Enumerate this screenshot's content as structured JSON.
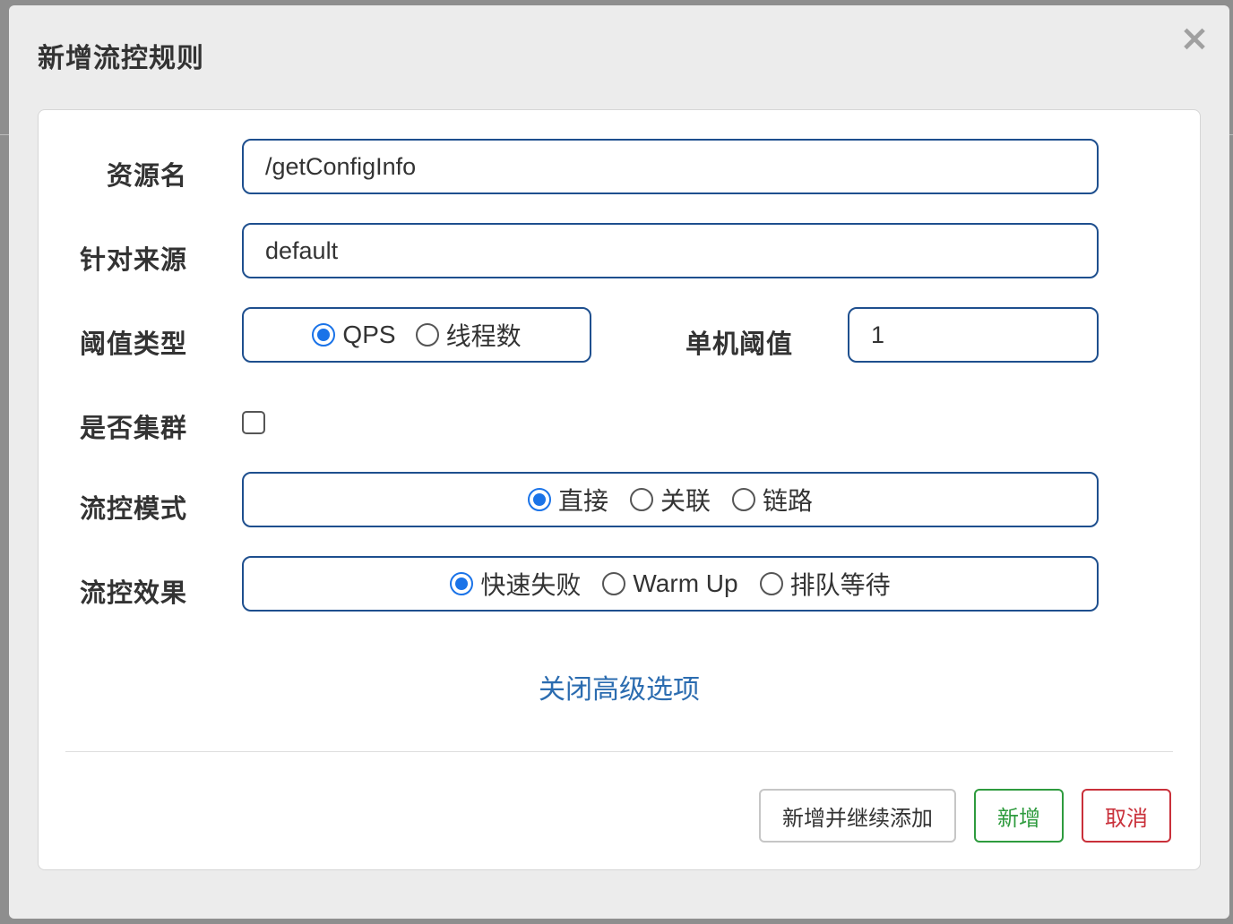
{
  "dialog": {
    "title": "新增流控规则"
  },
  "form": {
    "resource_name": {
      "label": "资源名",
      "value": "/getConfigInfo"
    },
    "limit_app": {
      "label": "针对来源",
      "value": "default"
    },
    "threshold_type": {
      "label": "阈值类型",
      "options": [
        {
          "label": "QPS",
          "checked": true
        },
        {
          "label": "线程数",
          "checked": false
        }
      ]
    },
    "single_threshold": {
      "label": "单机阈值",
      "value": "1"
    },
    "cluster": {
      "label": "是否集群",
      "checked": false
    },
    "flow_mode": {
      "label": "流控模式",
      "options": [
        {
          "label": "直接",
          "checked": true
        },
        {
          "label": "关联",
          "checked": false
        },
        {
          "label": "链路",
          "checked": false
        }
      ]
    },
    "control_behavior": {
      "label": "流控效果",
      "options": [
        {
          "label": "快速失败",
          "checked": true
        },
        {
          "label": "Warm Up",
          "checked": false
        },
        {
          "label": "排队等待",
          "checked": false
        }
      ]
    },
    "advanced_toggle": "关闭高级选项"
  },
  "footer": {
    "add_continue_label": "新增并继续添加",
    "add_label": "新增",
    "cancel_label": "取消"
  },
  "colors": {
    "accent_blue": "#1a73e8",
    "field_border": "#1e4f8e",
    "link_blue": "#2b6cb0",
    "add_green": "#2e9b3e",
    "cancel_red": "#c9303a"
  }
}
